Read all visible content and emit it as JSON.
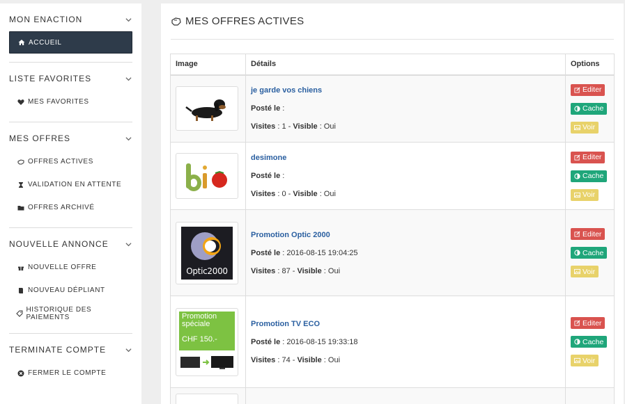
{
  "sidebar": {
    "sections": [
      {
        "title": "MON ENACTION",
        "items": [
          {
            "label": "ACCUEIL",
            "icon": "home-icon"
          }
        ]
      },
      {
        "title": "LISTE FAVORITES",
        "items": [
          {
            "label": "MES FAVORITES",
            "icon": "heart-icon"
          }
        ]
      },
      {
        "title": "MES OFFRES",
        "items": [
          {
            "label": "OFFRES ACTIVES",
            "icon": "hand-icon"
          },
          {
            "label": "VALIDATION EN ATTENTE",
            "icon": "hourglass-icon"
          },
          {
            "label": "OFFRES ARCHIVÉ",
            "icon": "folder-icon"
          }
        ]
      },
      {
        "title": "NOUVELLE ANNONCE",
        "items": [
          {
            "label": "NOUVELLE OFFRE",
            "icon": "gift-icon"
          },
          {
            "label": "NOUVEAU DÉPLIANT",
            "icon": "book-icon"
          },
          {
            "label": "HISTORIQUE DES PAIEMENTS",
            "icon": "tag-icon"
          }
        ]
      },
      {
        "title": "TERMINATE COMPTE",
        "items": [
          {
            "label": "FERMER LE COMPTE",
            "icon": "close-circle-icon"
          }
        ]
      }
    ]
  },
  "main": {
    "title": "MES OFFRES ACTIVES",
    "table": {
      "headers": [
        "Image",
        "Détails",
        "Options"
      ],
      "rows": [
        {
          "title": "je garde vos chiens",
          "posted_label": "Posté le",
          "posted_value": ":",
          "visits_label": "Visites",
          "visits_value": ": 1 - ",
          "visible_label": "Visible",
          "visible_value": ": Oui",
          "image": "dog-photo"
        },
        {
          "title": "desimone",
          "posted_label": "Posté le",
          "posted_value": ":",
          "visits_label": "Visites",
          "visits_value": ": 0 - ",
          "visible_label": "Visible",
          "visible_value": ": Oui",
          "image": "bio-logo"
        },
        {
          "title": "Promotion Optic 2000",
          "posted_label": "Posté le",
          "posted_value": ": 2016-08-15 19:04:25",
          "visits_label": "Visites",
          "visits_value": ": 87 - ",
          "visible_label": "Visible",
          "visible_value": ": Oui",
          "image": "optic2000-logo",
          "image_text": "Optic2000"
        },
        {
          "title": "Promotion TV ECO",
          "posted_label": "Posté le",
          "posted_value": ": 2016-08-15 19:33:18",
          "visits_label": "Visites",
          "visits_value": ": 74 - ",
          "visible_label": "Visible",
          "visible_value": ": Oui",
          "image": "tv-promo",
          "image_text_1": "Promotion",
          "image_text_2": "spéciale",
          "image_text_3": "CHF 150.-"
        }
      ]
    },
    "buttons": {
      "edit": "Editer",
      "hide": "Cache",
      "view": "Voir"
    }
  },
  "colors": {
    "sidebar_active_bg": "#2e3b4a",
    "link": "#2a5fa0",
    "edit": "#d9534f",
    "hide": "#1fa67a",
    "view": "#e8d26a"
  }
}
